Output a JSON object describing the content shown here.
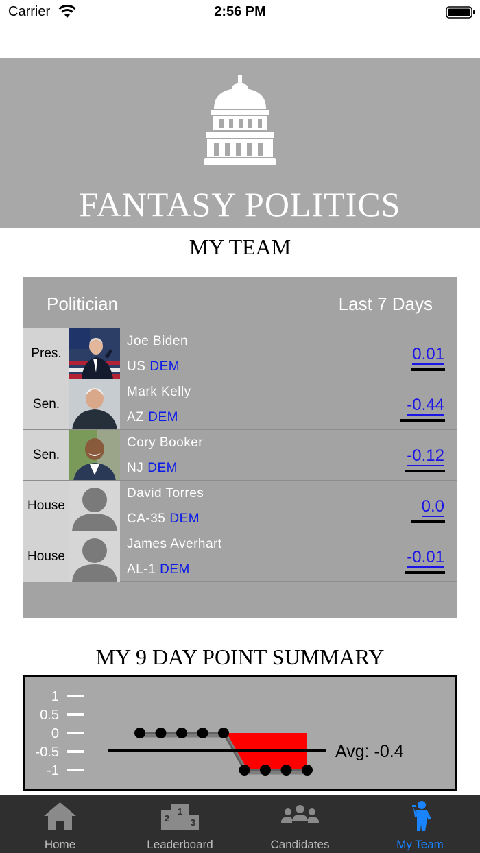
{
  "status_bar": {
    "carrier": "Carrier",
    "time": "2:56 PM"
  },
  "header": {
    "app_title": "FANTASY POLITICS",
    "logo": "capitol-building-icon"
  },
  "my_team": {
    "title": "MY TEAM",
    "columns": {
      "politician": "Politician",
      "last_7_days": "Last 7 Days"
    },
    "rows": [
      {
        "office": "Pres.",
        "name": "Joe Biden",
        "state": "US",
        "party": "DEM",
        "score": "0.01"
      },
      {
        "office": "Sen.",
        "name": "Mark Kelly",
        "state": "AZ",
        "party": "DEM",
        "score": "-0.44"
      },
      {
        "office": "Sen.",
        "name": "Cory Booker",
        "state": "NJ",
        "party": "DEM",
        "score": "-0.12"
      },
      {
        "office": "House",
        "name": "David Torres",
        "state": "CA-35",
        "party": "DEM",
        "score": "0.0"
      },
      {
        "office": "House",
        "name": "James Averhart",
        "state": "AL-1",
        "party": "DEM",
        "score": "-0.01"
      }
    ]
  },
  "summary": {
    "title": "MY 9 DAY POINT SUMMARY",
    "avg_label": "Avg: -0.4"
  },
  "chart_data": {
    "type": "line",
    "title": "MY 9 DAY POINT SUMMARY",
    "x": [
      1,
      2,
      3,
      4,
      5,
      6,
      7,
      8,
      9
    ],
    "series": [
      {
        "values": [
          0,
          0,
          0,
          0,
          0,
          -1,
          -1,
          -1,
          -1
        ]
      }
    ],
    "average": -0.4,
    "y_ticks": [
      "1",
      "0.5",
      "0",
      "-0.5",
      "-1"
    ],
    "ylim": [
      -1,
      1
    ],
    "grid": false,
    "colors": {
      "negative_fill": "#ff0000",
      "line": "#000000"
    }
  },
  "tab_bar": {
    "tabs": [
      {
        "label": "Home",
        "icon": "home-icon",
        "active": false
      },
      {
        "label": "Leaderboard",
        "icon": "podium-icon",
        "active": false
      },
      {
        "label": "Candidates",
        "icon": "group-icon",
        "active": false
      },
      {
        "label": "My Team",
        "icon": "person-icon",
        "active": true
      }
    ],
    "active_color": "#1a83ff",
    "inactive_color": "#bdbdbd"
  }
}
